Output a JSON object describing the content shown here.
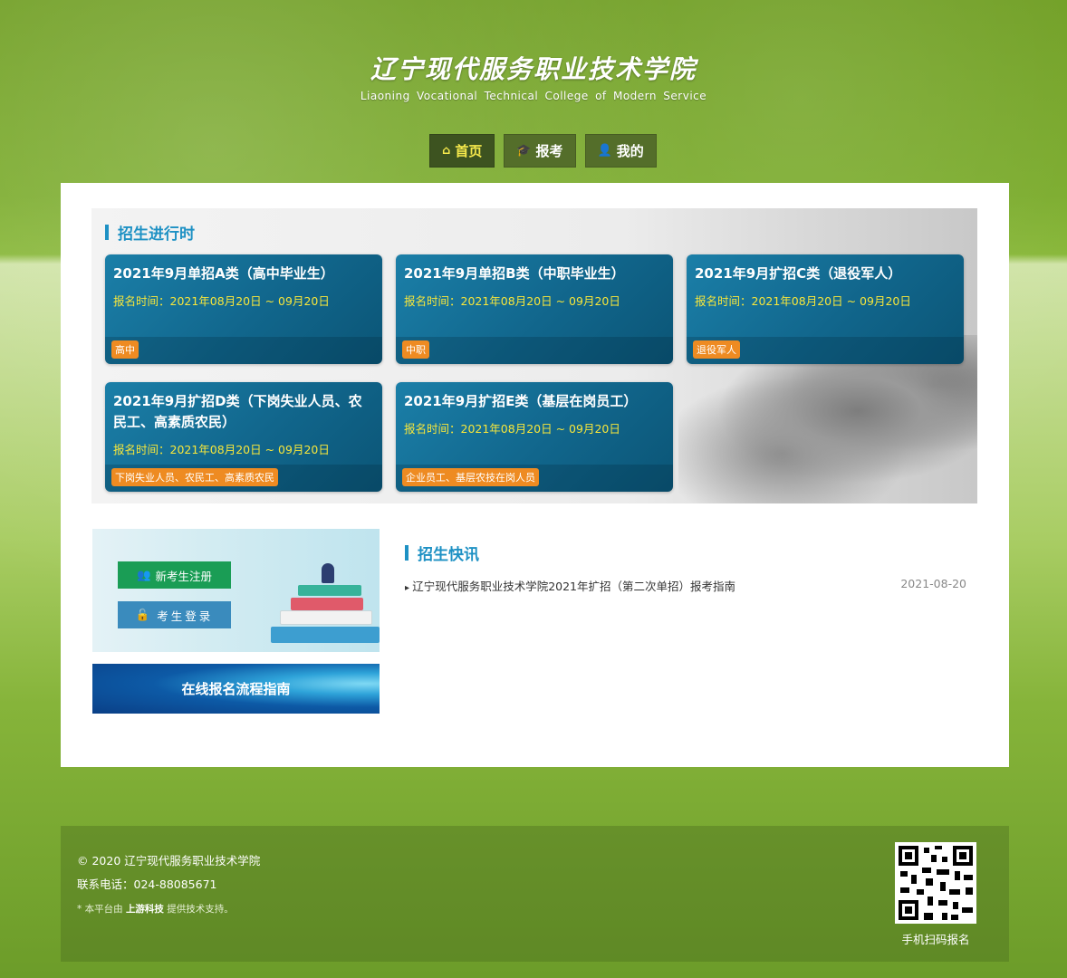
{
  "header": {
    "logo_cn": "辽宁现代服务职业技术学院",
    "logo_en": "Liaoning Vocational Technical College of Modern Service"
  },
  "nav": [
    {
      "label": "首页",
      "icon": "home-icon"
    },
    {
      "label": "报考",
      "icon": "graduation-cap-icon"
    },
    {
      "label": "我的",
      "icon": "user-icon"
    }
  ],
  "recruit": {
    "title": "招生进行时",
    "cards": [
      {
        "title": "2021年9月单招A类（高中毕业生）",
        "date": "报名时间：2021年08月20日 ~ 09月20日",
        "tag": "高中"
      },
      {
        "title": "2021年9月单招B类（中职毕业生）",
        "date": "报名时间：2021年08月20日 ~ 09月20日",
        "tag": "中职"
      },
      {
        "title": "2021年9月扩招C类（退役军人）",
        "date": "报名时间：2021年08月20日 ~ 09月20日",
        "tag": "退役军人"
      },
      {
        "title": "2021年9月扩招D类（下岗失业人员、农民工、高素质农民）",
        "date": "报名时间：2021年08月20日 ~ 09月20日",
        "tag": "下岗失业人员、农民工、高素质农民"
      },
      {
        "title": "2021年9月扩招E类（基层在岗员工）",
        "date": "报名时间：2021年08月20日 ~ 09月20日",
        "tag": "企业员工、基层农技在岗人员"
      }
    ]
  },
  "account": {
    "register_label": "新考生注册",
    "login_label": "考生登录",
    "guide_label": "在线报名流程指南"
  },
  "news": {
    "title": "招生快讯",
    "items": [
      {
        "text": "辽宁现代服务职业技术学院2021年扩招（第二次单招）报考指南",
        "date": "2021-08-20"
      }
    ]
  },
  "footer": {
    "copyright": "© 2020 辽宁现代服务职业技术学院",
    "phone": "联系电话：024-88085671",
    "note_prefix": "* 本平台由",
    "note_brand": "上游科技",
    "note_suffix": "提供技术支持。",
    "qr_label": "手机扫码报名"
  }
}
